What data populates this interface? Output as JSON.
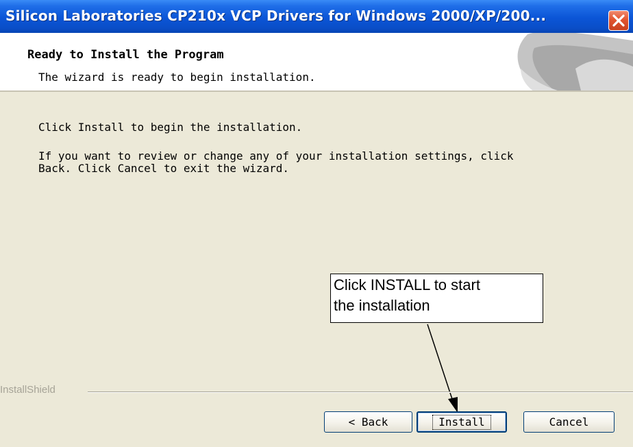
{
  "window": {
    "title": "Silicon Laboratories CP210x VCP Drivers for Windows 2000/XP/200..."
  },
  "header": {
    "title": "Ready to Install the Program",
    "subtitle": "The wizard is ready to begin installation."
  },
  "body": {
    "line1": "Click Install to begin the installation.",
    "line2": "If you want to review or change any of your installation settings, click",
    "line3": "Back. Click Cancel to exit the wizard."
  },
  "callout": {
    "line1": "Click INSTALL to start",
    "line2": "the installation"
  },
  "footer": {
    "brand": "InstallShield",
    "back_label": "< Back",
    "install_label": "Install",
    "cancel_label": "Cancel"
  },
  "icons": [
    "close-icon"
  ],
  "colors": {
    "titlebar": "#0b55d6",
    "close": "#e2552f",
    "dialog_bg": "#ece9d8"
  }
}
